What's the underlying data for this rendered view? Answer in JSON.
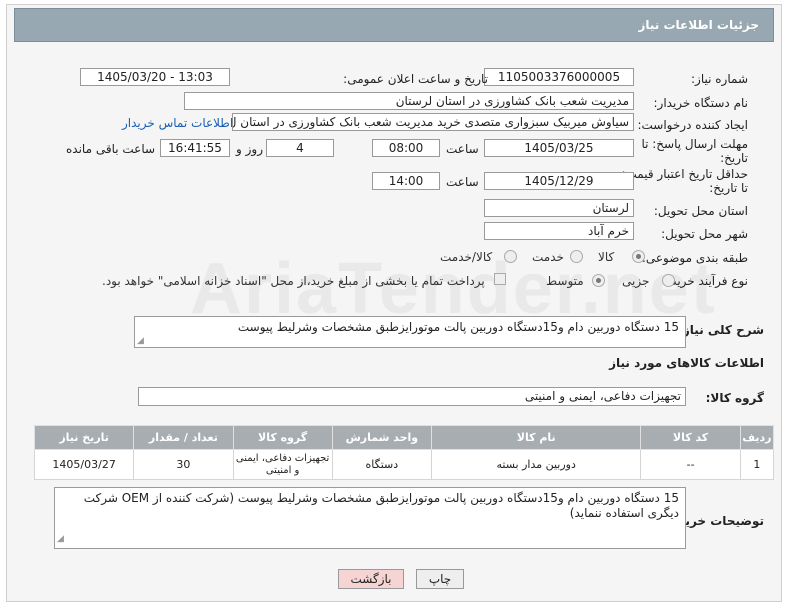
{
  "header": {
    "title": "جزئیات اطلاعات نیاز"
  },
  "watermark": "AriaTender.net",
  "form": {
    "need_number_label": "شماره نیاز:",
    "need_number": "1105003376000005",
    "announce_label": "تاریخ و ساعت اعلان عمومی:",
    "announce_value": "1405/03/20 - 13:03",
    "buyer_org_label": "نام دستگاه خریدار:",
    "buyer_org": "مدیریت شعب بانک کشاورزی در استان لرستان",
    "creator_label": "ایجاد کننده درخواست:",
    "creator": "سیاوش میربیک سبزواری متصدی خرید مدیریت شعب بانک کشاورزی در استان ل",
    "contact_link": "اطلاعات تماس خریدار",
    "reply_label_1": "مهلت ارسال پاسخ: تا",
    "reply_label_2": "تاریخ:",
    "reply_date": "1405/03/25",
    "time_word": "ساعت",
    "reply_time": "08:00",
    "day_word": "روز و",
    "reply_days": "4",
    "reply_remaining": "16:41:55",
    "remaining_word": "ساعت باقی مانده",
    "validity_label_1": "حداقل تاریخ اعتبار قیمت:",
    "validity_label_2": "تا تاریخ:",
    "validity_date": "1405/12/29",
    "validity_time": "14:00",
    "province_label": "استان محل تحویل:",
    "province": "لرستان",
    "city_label": "شهر محل تحویل:",
    "city": "خرم آباد",
    "category_label": "طبقه بندی موضوعی:",
    "category_options": [
      "کالا",
      "خدمت",
      "کالا/خدمت"
    ],
    "category_selected": "کالا",
    "process_label": "نوع فرآیند خرید :",
    "process_options": [
      "جزیی",
      "متوسط"
    ],
    "process_selected": "متوسط",
    "payment_note": "پرداخت تمام یا بخشی از مبلغ خرید،از محل \"اسناد خزانه اسلامی\" خواهد بود."
  },
  "summary": {
    "label": "شرح کلی نیاز:",
    "text": "15 دستگاه دوربین دام و15دستگاه دوربین پالت موتورایزطبق مشخصات وشرلیط پیوست"
  },
  "goods": {
    "section_title": "اطلاعات کالاهای مورد نیاز",
    "group_label": "گروه کالا:",
    "group_value": "تجهیزات دفاعی، ایمنی و امنیتی",
    "columns": [
      "ردیف",
      "کد کالا",
      "نام کالا",
      "واحد شمارش",
      "گروه کالا",
      "تعداد / مقدار",
      "تاریخ نیاز"
    ],
    "rows": [
      [
        "1",
        "--",
        "دوربین مدار بسته",
        "دستگاه",
        "تجهیزات دفاعی، ایمنی و امنیتی",
        "30",
        "1405/03/27"
      ]
    ]
  },
  "buyer_notes": {
    "label": "توضیحات خریدار:",
    "text": "15 دستگاه دوربین دام و15دستگاه دوربین پالت موتورایزطبق مشخصات وشرلیط پیوست (شرکت کننده از OEM شرکت دیگری استفاده ننماید)"
  },
  "buttons": {
    "print": "چاپ",
    "back": "بازگشت"
  },
  "colors": {
    "header": "#97a8b3",
    "table_header": "#a8adb2",
    "link": "#1a5fb4",
    "back_button": "#f6d4d4",
    "print_button": "#eeeeee"
  }
}
